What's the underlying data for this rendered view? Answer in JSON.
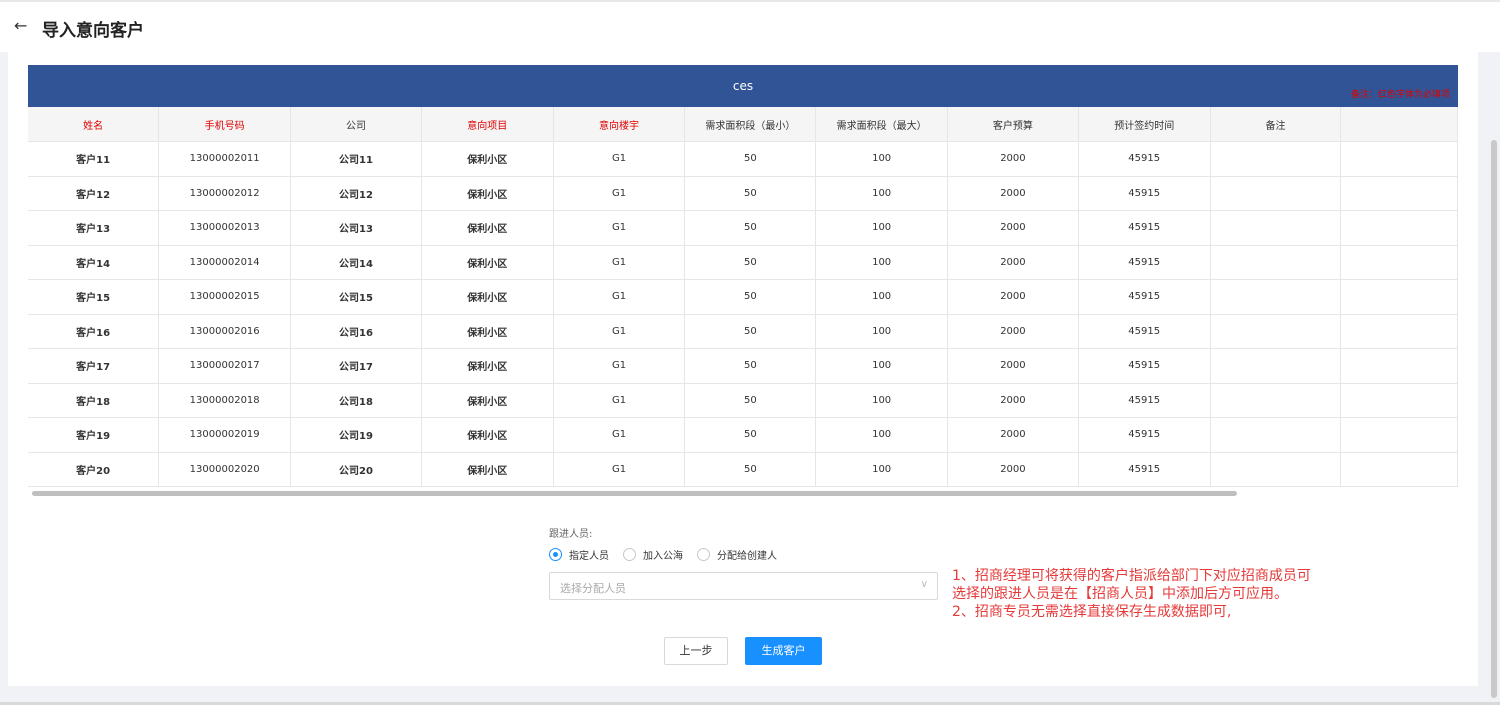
{
  "header": {
    "title": "导入意向客户",
    "back_icon": "←"
  },
  "sheet": {
    "name": "ces",
    "note": "备注：红色字体为必填项",
    "columns": [
      {
        "label": "姓名",
        "required": true
      },
      {
        "label": "手机号码",
        "required": true
      },
      {
        "label": "公司",
        "required": false
      },
      {
        "label": "意向项目",
        "required": true
      },
      {
        "label": "意向楼宇",
        "required": true
      },
      {
        "label": "需求面积段（最小）",
        "required": false
      },
      {
        "label": "需求面积段（最大）",
        "required": false
      },
      {
        "label": "客户预算",
        "required": false
      },
      {
        "label": "预计签约时间",
        "required": false
      },
      {
        "label": "备注",
        "required": false
      },
      {
        "label": "",
        "required": false
      }
    ],
    "rows": [
      [
        "客户11",
        "13000002011",
        "公司11",
        "保利小区",
        "G1",
        "50",
        "100",
        "2000",
        "45915",
        "",
        ""
      ],
      [
        "客户12",
        "13000002012",
        "公司12",
        "保利小区",
        "G1",
        "50",
        "100",
        "2000",
        "45915",
        "",
        ""
      ],
      [
        "客户13",
        "13000002013",
        "公司13",
        "保利小区",
        "G1",
        "50",
        "100",
        "2000",
        "45915",
        "",
        ""
      ],
      [
        "客户14",
        "13000002014",
        "公司14",
        "保利小区",
        "G1",
        "50",
        "100",
        "2000",
        "45915",
        "",
        ""
      ],
      [
        "客户15",
        "13000002015",
        "公司15",
        "保利小区",
        "G1",
        "50",
        "100",
        "2000",
        "45915",
        "",
        ""
      ],
      [
        "客户16",
        "13000002016",
        "公司16",
        "保利小区",
        "G1",
        "50",
        "100",
        "2000",
        "45915",
        "",
        ""
      ],
      [
        "客户17",
        "13000002017",
        "公司17",
        "保利小区",
        "G1",
        "50",
        "100",
        "2000",
        "45915",
        "",
        ""
      ],
      [
        "客户18",
        "13000002018",
        "公司18",
        "保利小区",
        "G1",
        "50",
        "100",
        "2000",
        "45915",
        "",
        ""
      ],
      [
        "客户19",
        "13000002019",
        "公司19",
        "保利小区",
        "G1",
        "50",
        "100",
        "2000",
        "45915",
        "",
        ""
      ],
      [
        "客户20",
        "13000002020",
        "公司20",
        "保利小区",
        "G1",
        "50",
        "100",
        "2000",
        "45915",
        "",
        ""
      ]
    ]
  },
  "follow": {
    "label": "跟进人员:",
    "options": [
      {
        "label": "指定人员",
        "checked": true
      },
      {
        "label": "加入公海",
        "checked": false
      },
      {
        "label": "分配给创建人",
        "checked": false
      }
    ],
    "select_placeholder": "选择分配人员"
  },
  "instructions": [
    "1、招商经理可将获得的客户指派给部门下对应招商成员可选择的跟进人员是在【招商人员】中添加后方可应用。",
    "2、招商专员无需选择直接保存生成数据即可,"
  ],
  "buttons": {
    "prev": "上一步",
    "generate": "生成客户"
  },
  "colors": {
    "banner": "#305496",
    "required_text": "#e00000",
    "primary": "#1890ff",
    "note_text": "#e63a3a"
  }
}
